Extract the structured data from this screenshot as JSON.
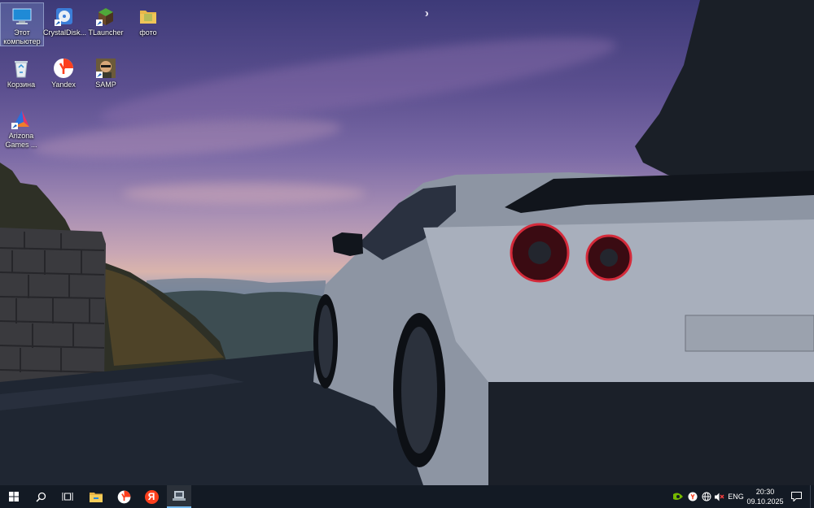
{
  "desktop": {
    "icons": [
      {
        "label_line1": "Этот",
        "label_line2": "компьютер",
        "icon": "this-pc-icon"
      },
      {
        "label": "CrystalDisk...",
        "icon": "crystaldisk-icon"
      },
      {
        "label": "TLauncher",
        "icon": "tlauncher-icon"
      },
      {
        "label": "фото",
        "icon": "folder-icon"
      },
      {
        "label": "Корзина",
        "icon": "recycle-bin-icon"
      },
      {
        "label": "Yandex",
        "icon": "yandex-browser-icon"
      },
      {
        "label": "SAMP",
        "icon": "samp-icon"
      },
      {
        "label_line1": "Arizona",
        "label_line2": "Games ...",
        "icon": "arizona-games-icon"
      }
    ]
  },
  "taskbar": {
    "pinned": [
      "windows-start-icon",
      "search-icon",
      "task-view-icon",
      "file-explorer-icon",
      "yandex-browser-icon",
      "yandex-icon",
      "app-icon"
    ],
    "tray": {
      "icons": [
        "nvidia-icon",
        "yandex-tray-icon",
        "network-globe-icon",
        "volume-muted-icon"
      ],
      "language": "ENG",
      "time": "20:30",
      "date": "09.10.2025"
    }
  },
  "colors": {
    "taskbar_bg": "#131a24",
    "active_underline": "#76b9ed",
    "yandex_red": "#fc3f1d"
  }
}
